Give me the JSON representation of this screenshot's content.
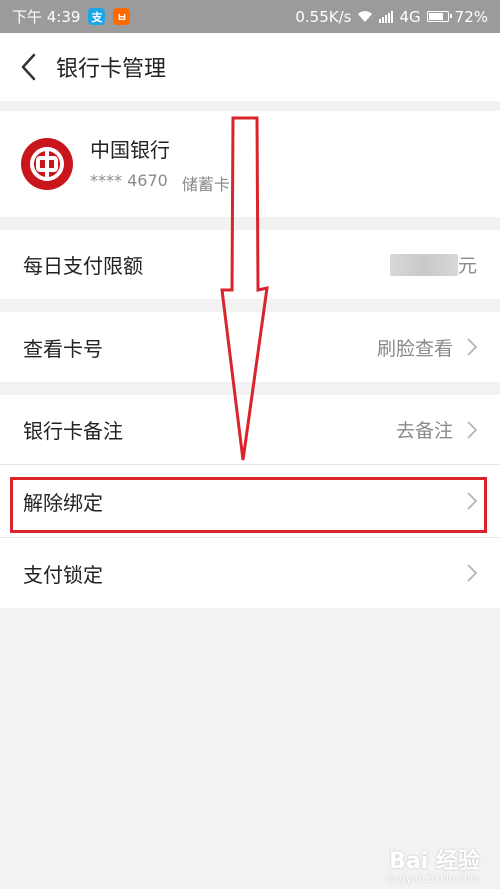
{
  "status_bar": {
    "time": "下午 4:39",
    "apps": [
      {
        "icon": "alipay-icon",
        "glyph": "支"
      },
      {
        "icon": "taobao-icon",
        "glyph": "ㅂ"
      }
    ],
    "network_speed": "0.55K/s",
    "network_type": "4G",
    "battery": "72%"
  },
  "header": {
    "title": "银行卡管理"
  },
  "card": {
    "bank_name": "中国银行",
    "masked_number": "**** 4670",
    "card_type": "储蓄卡",
    "logo_color": "#c8161d"
  },
  "rows": {
    "daily_limit": {
      "label": "每日支付限额",
      "unit": "元"
    },
    "view_number": {
      "label": "查看卡号",
      "value": "刷脸查看"
    },
    "card_note": {
      "label": "银行卡备注",
      "value": "去备注"
    },
    "unbind": {
      "label": "解除绑定"
    },
    "pay_lock": {
      "label": "支付锁定"
    }
  },
  "watermark": {
    "text": "Bai 经验",
    "url": "jingyan.baidu.com"
  },
  "colors": {
    "annotation_red": "#d8242a"
  }
}
